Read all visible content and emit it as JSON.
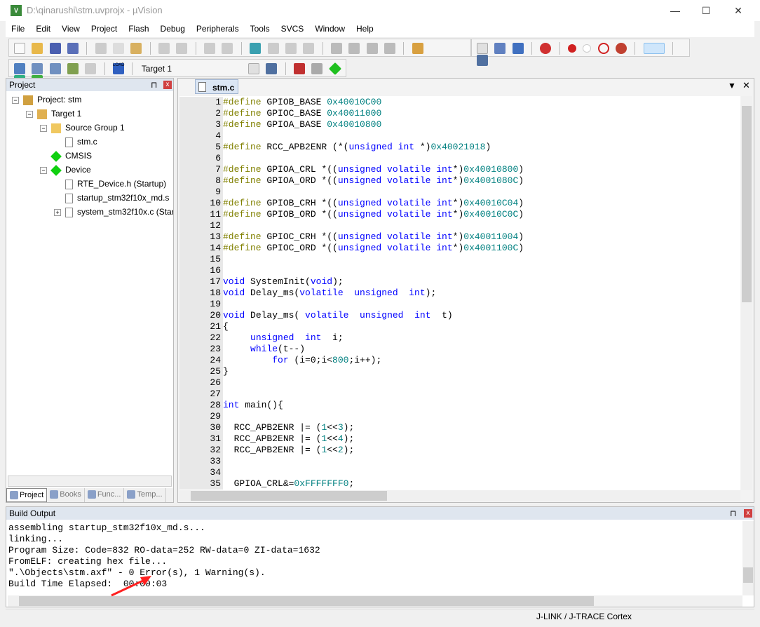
{
  "window": {
    "title": "D:\\qinarushi\\stm.uvprojx - µVision",
    "minimize": "—",
    "maximize": "☐",
    "close": "✕"
  },
  "menu": [
    "File",
    "Edit",
    "View",
    "Project",
    "Flash",
    "Debug",
    "Peripherals",
    "Tools",
    "SVCS",
    "Window",
    "Help"
  ],
  "toolbar2": {
    "target": "Target 1",
    "load_label": "LOAD"
  },
  "project_panel": {
    "title": "Project",
    "pin": "⊓",
    "close": "x",
    "tree": [
      {
        "label": "Project: stm",
        "depth": 0,
        "icon": "project-icon",
        "expander": "−"
      },
      {
        "label": "Target 1",
        "depth": 1,
        "icon": "target-folder-icon",
        "expander": "−"
      },
      {
        "label": "Source Group 1",
        "depth": 2,
        "icon": "folder-icon",
        "expander": "−"
      },
      {
        "label": "stm.c",
        "depth": 3,
        "icon": "file-icon",
        "expander": ""
      },
      {
        "label": "CMSIS",
        "depth": 2,
        "icon": "component-icon",
        "expander": ""
      },
      {
        "label": "Device",
        "depth": 2,
        "icon": "component-icon",
        "expander": "−"
      },
      {
        "label": "RTE_Device.h (Startup)",
        "depth": 3,
        "icon": "file-icon",
        "expander": ""
      },
      {
        "label": "startup_stm32f10x_md.s",
        "depth": 3,
        "icon": "file-icon",
        "expander": ""
      },
      {
        "label": "system_stm32f10x.c (Star",
        "depth": 3,
        "icon": "file-icon",
        "expander": "+"
      }
    ],
    "tabs": [
      {
        "label": "Project",
        "icon": "project-tab-icon"
      },
      {
        "label": "Books",
        "icon": "books-icon"
      },
      {
        "label": "Func...",
        "icon": "functions-icon"
      },
      {
        "label": "Temp...",
        "icon": "templates-icon"
      }
    ]
  },
  "editor": {
    "tab": "stm.c",
    "lines": [
      [
        [
          "pp",
          "#define"
        ],
        [
          "pl",
          " GPIOB_BASE "
        ],
        [
          "hx",
          "0x40010C00"
        ]
      ],
      [
        [
          "pp",
          "#define"
        ],
        [
          "pl",
          " GPIOC_BASE "
        ],
        [
          "hx",
          "0x40011000"
        ]
      ],
      [
        [
          "pp",
          "#define"
        ],
        [
          "pl",
          " GPIOA_BASE "
        ],
        [
          "hx",
          "0x40010800"
        ]
      ],
      [],
      [
        [
          "pp",
          "#define"
        ],
        [
          "pl",
          " RCC_APB2ENR (*("
        ],
        [
          "kw",
          "unsigned int"
        ],
        [
          "pl",
          " *)"
        ],
        [
          "hx",
          "0x40021018"
        ],
        [
          "pl",
          ")"
        ]
      ],
      [],
      [
        [
          "pp",
          "#define"
        ],
        [
          "pl",
          " GPIOA_CRL *(("
        ],
        [
          "kw",
          "unsigned volatile int"
        ],
        [
          "pl",
          "*)"
        ],
        [
          "hx",
          "0x40010800"
        ],
        [
          "pl",
          ")"
        ]
      ],
      [
        [
          "pp",
          "#define"
        ],
        [
          "pl",
          " GPIOA_ORD *(("
        ],
        [
          "kw",
          "unsigned volatile int"
        ],
        [
          "pl",
          "*)"
        ],
        [
          "hx",
          "0x4001080C"
        ],
        [
          "pl",
          ")"
        ]
      ],
      [],
      [
        [
          "pp",
          "#define"
        ],
        [
          "pl",
          " GPIOB_CRH *(("
        ],
        [
          "kw",
          "unsigned volatile int"
        ],
        [
          "pl",
          "*)"
        ],
        [
          "hx",
          "0x40010C04"
        ],
        [
          "pl",
          ")"
        ]
      ],
      [
        [
          "pp",
          "#define"
        ],
        [
          "pl",
          " GPIOB_ORD *(("
        ],
        [
          "kw",
          "unsigned volatile int"
        ],
        [
          "pl",
          "*)"
        ],
        [
          "hx",
          "0x40010C0C"
        ],
        [
          "pl",
          ")"
        ]
      ],
      [],
      [
        [
          "pp",
          "#define"
        ],
        [
          "pl",
          " GPIOC_CRH *(("
        ],
        [
          "kw",
          "unsigned volatile int"
        ],
        [
          "pl",
          "*)"
        ],
        [
          "hx",
          "0x40011004"
        ],
        [
          "pl",
          ")"
        ]
      ],
      [
        [
          "pp",
          "#define"
        ],
        [
          "pl",
          " GPIOC_ORD *(("
        ],
        [
          "kw",
          "unsigned volatile int"
        ],
        [
          "pl",
          "*)"
        ],
        [
          "hx",
          "0x4001100C"
        ],
        [
          "pl",
          ")"
        ]
      ],
      [],
      [],
      [
        [
          "kw",
          "void"
        ],
        [
          "pl",
          " SystemInit("
        ],
        [
          "kw",
          "void"
        ],
        [
          "pl",
          ");"
        ]
      ],
      [
        [
          "kw",
          "void"
        ],
        [
          "pl",
          " Delay_ms("
        ],
        [
          "kw",
          "volatile  unsigned  int"
        ],
        [
          "pl",
          ");"
        ]
      ],
      [],
      [
        [
          "kw",
          "void"
        ],
        [
          "pl",
          " Delay_ms( "
        ],
        [
          "kw",
          "volatile  unsigned  int"
        ],
        [
          "pl",
          "  t)"
        ]
      ],
      [
        [
          "pl",
          "{"
        ]
      ],
      [
        [
          "pl",
          "     "
        ],
        [
          "kw",
          "unsigned  int"
        ],
        [
          "pl",
          "  i;"
        ]
      ],
      [
        [
          "pl",
          "     "
        ],
        [
          "kw",
          "while"
        ],
        [
          "pl",
          "(t--)"
        ]
      ],
      [
        [
          "pl",
          "         "
        ],
        [
          "kw",
          "for"
        ],
        [
          "pl",
          " (i=0;i<"
        ],
        [
          "hx",
          "800"
        ],
        [
          "pl",
          ";i++);"
        ]
      ],
      [
        [
          "pl",
          "}"
        ]
      ],
      [],
      [],
      [
        [
          "kw",
          "int"
        ],
        [
          "pl",
          " main(){"
        ]
      ],
      [],
      [
        [
          "pl",
          "  RCC_APB2ENR |= ("
        ],
        [
          "hx",
          "1"
        ],
        [
          "pl",
          "<<"
        ],
        [
          "hx",
          "3"
        ],
        [
          "pl",
          ");"
        ]
      ],
      [
        [
          "pl",
          "  RCC_APB2ENR |= ("
        ],
        [
          "hx",
          "1"
        ],
        [
          "pl",
          "<<"
        ],
        [
          "hx",
          "4"
        ],
        [
          "pl",
          ");"
        ]
      ],
      [
        [
          "pl",
          "  RCC_APB2ENR |= ("
        ],
        [
          "hx",
          "1"
        ],
        [
          "pl",
          "<<"
        ],
        [
          "hx",
          "2"
        ],
        [
          "pl",
          ");"
        ]
      ],
      [],
      [],
      [
        [
          "pl",
          "  GPIOA_CRL&="
        ],
        [
          "hx",
          "0xFFFFFFF0"
        ],
        [
          "pl",
          ";"
        ]
      ]
    ]
  },
  "build_output": {
    "title": "Build Output",
    "lines": [
      "assembling startup_stm32f10x_md.s...",
      "linking...",
      "Program Size: Code=832 RO-data=252 RW-data=0 ZI-data=1632",
      "FromELF: creating hex file...",
      "\".\\Objects\\stm.axf\" - 0 Error(s), 1 Warning(s).",
      "Build Time Elapsed:  00:00:03"
    ]
  },
  "status": {
    "debugger": "J-LINK / J-TRACE Cortex"
  },
  "colors": {
    "preprocessor": "#808000",
    "keyword": "#0000ff",
    "number": "#008080",
    "annotation_arrow": "#ff2020"
  }
}
